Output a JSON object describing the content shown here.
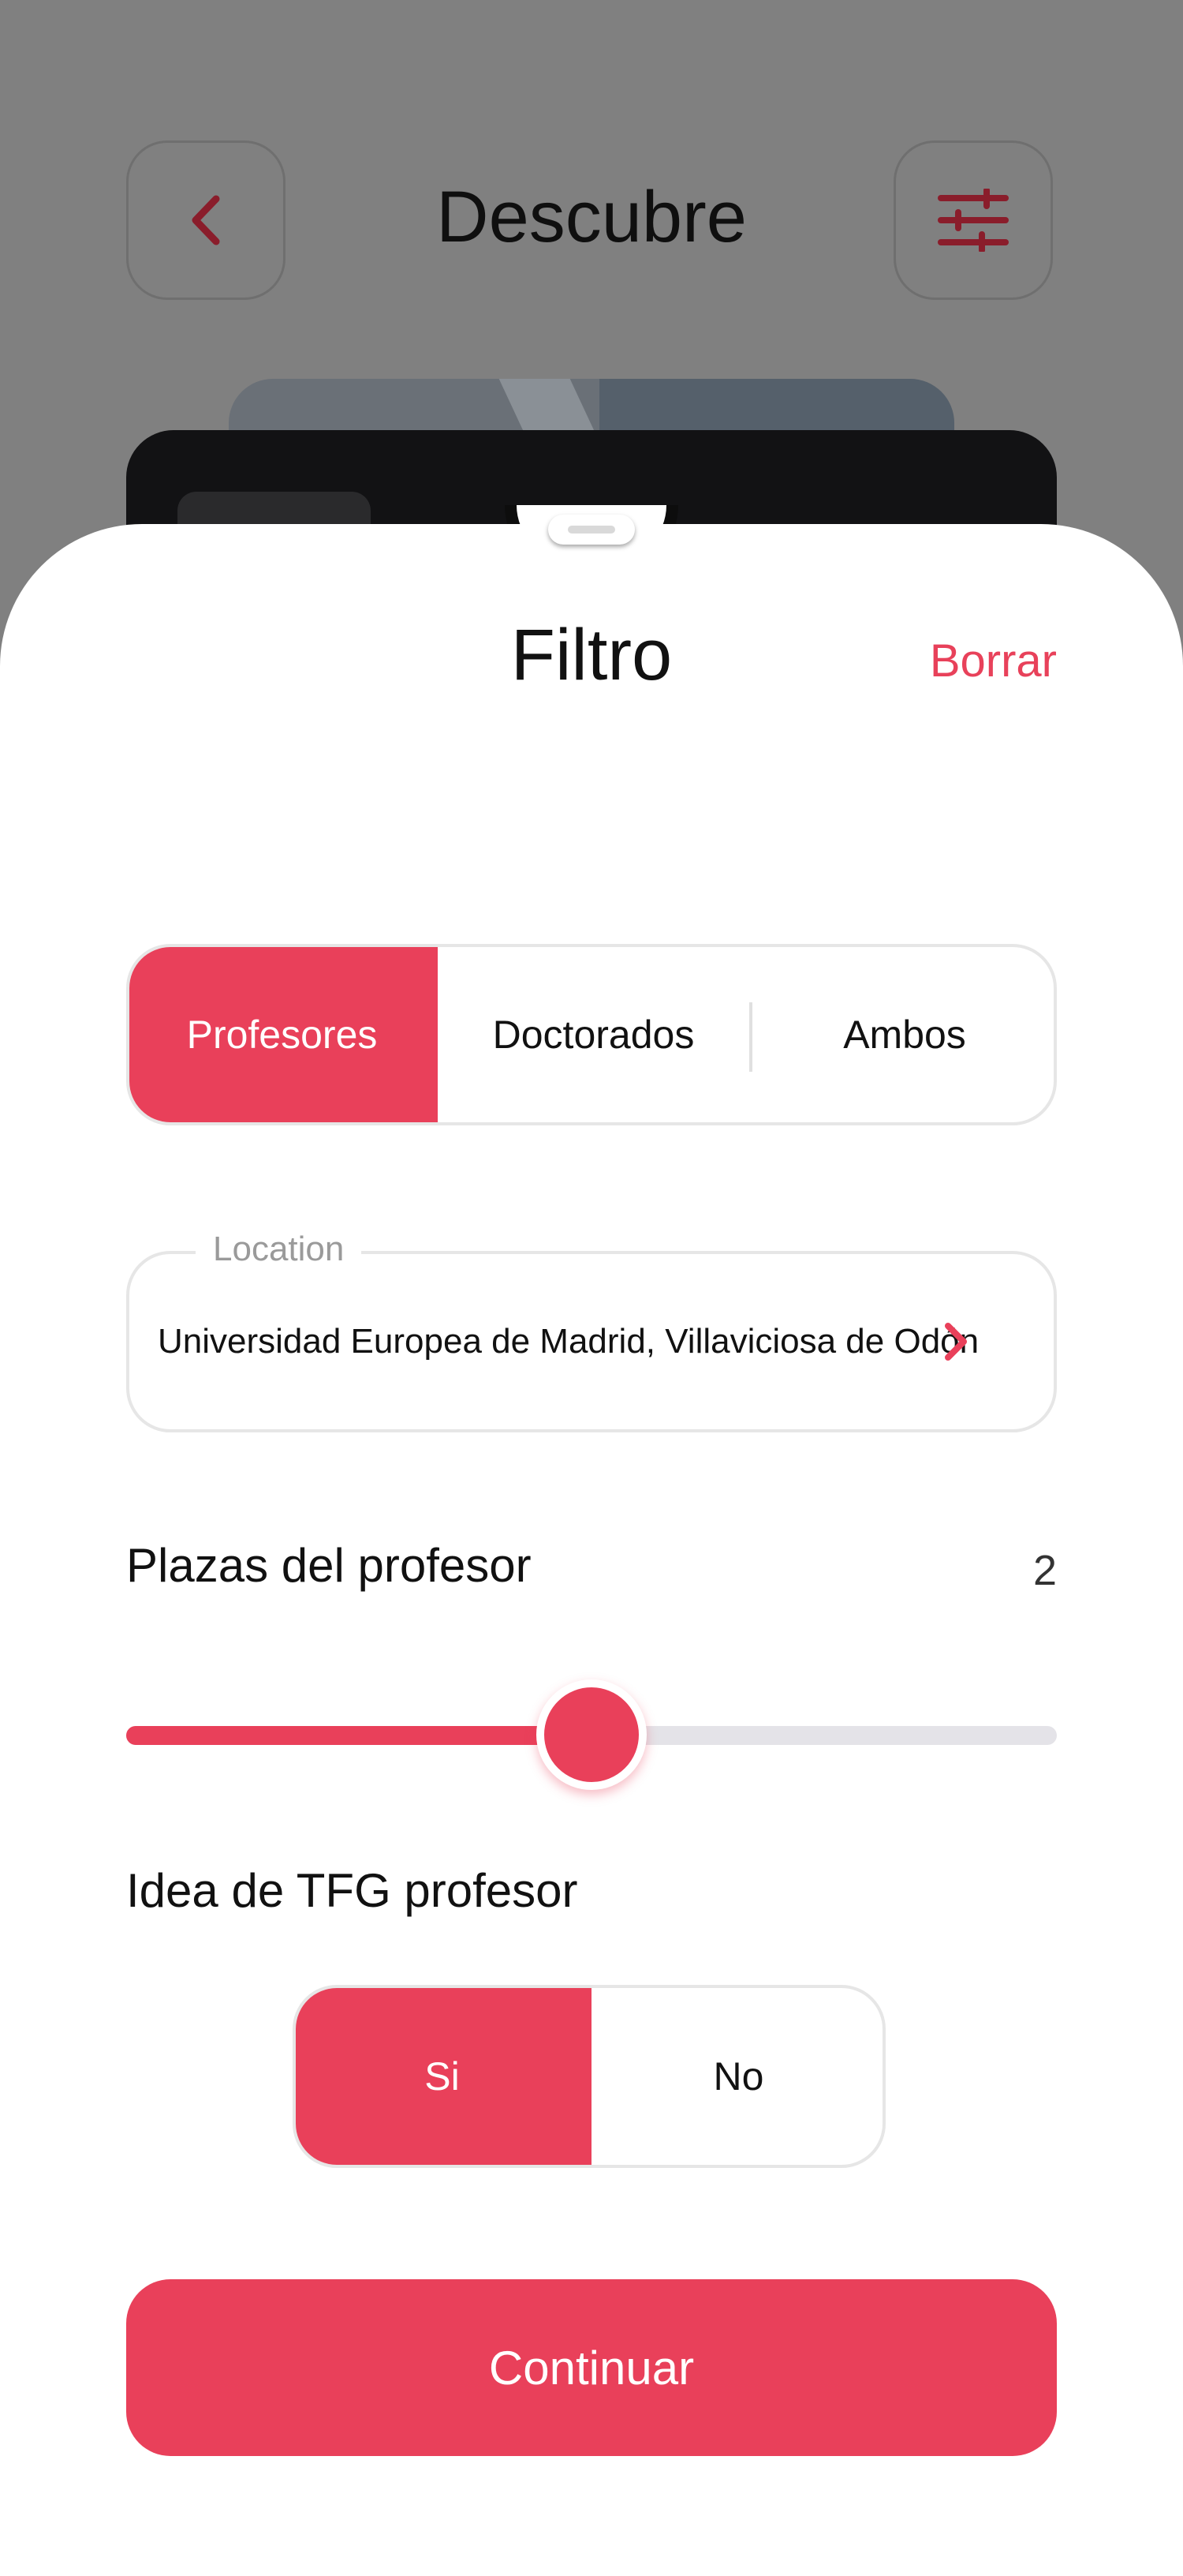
{
  "background": {
    "title": "Descubre",
    "back_icon": "chevron-left-icon",
    "filter_icon": "sliders-icon"
  },
  "sheet": {
    "title": "Filtro",
    "clear_label": "Borrar",
    "type_options": [
      {
        "label": "Profesores",
        "selected": true
      },
      {
        "label": "Doctorados",
        "selected": false
      },
      {
        "label": "Ambos",
        "selected": false
      }
    ],
    "location": {
      "label": "Location",
      "value": "Universidad Europea de Madrid, Villaviciosa de Odón"
    },
    "seats": {
      "label": "Plazas del profesor",
      "value": "2",
      "slider_fraction": 0.5
    },
    "tfg": {
      "label": "Idea de TFG profesor",
      "options": [
        {
          "label": "Si",
          "selected": true
        },
        {
          "label": "No",
          "selected": false
        }
      ]
    },
    "continue_label": "Continuar"
  },
  "colors": {
    "accent": "#e9405a",
    "dim_overlay": "#808080"
  }
}
